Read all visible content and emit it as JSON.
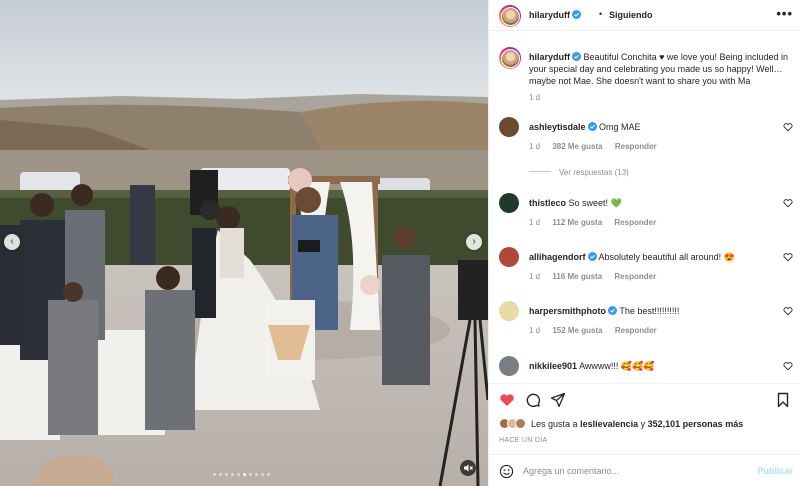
{
  "post": {
    "username": "hilaryduff",
    "follow_status": "Siguiendo",
    "more_label": "•••",
    "caption": "Beautiful Conchita ♥ we love you! Being included in your special day and celebrating you made us so happy! Well… maybe not Mae. She doesn't want to share you with Ma",
    "caption_time": "1 d"
  },
  "media": {
    "prev_icon": "‹",
    "next_icon": "›",
    "slide_count": 10,
    "active_slide": 6
  },
  "comments": [
    {
      "username": "ashleytisdale",
      "text": "Omg MAE",
      "time": "1 d",
      "likes": "382 Me gusta",
      "reply": "Responder",
      "avatar_color": "#6b4a2e"
    },
    {
      "username": "thistleco",
      "text": "So sweet! 💚",
      "time": "1 d",
      "likes": "112 Me gusta",
      "reply": "Responder",
      "avatar_color": "#1f3a2b"
    },
    {
      "username": "allihagendorf",
      "text": "Absolutely beautiful all around! 😍",
      "time": "1 d",
      "likes": "116 Me gusta",
      "reply": "Responder",
      "avatar_color": "#b0473a"
    },
    {
      "username": "harpersmithphoto",
      "text": "The best!!!!!!!!!!",
      "time": "1 d",
      "likes": "152 Me gusta",
      "reply": "Responder",
      "avatar_color": "#e7d9a8"
    },
    {
      "username": "nikkilee901",
      "text": "Awwww!!! 🥰🥰🥰",
      "time": "",
      "likes": "",
      "reply": "",
      "avatar_color": "#7a7f86"
    }
  ],
  "replies_label": "Ver respuestas (13)",
  "likes": {
    "prefix": "Les gusta a",
    "user": "lesliev​alencia",
    "connector": "y",
    "count": "352,101 personas más"
  },
  "post_time": "HACE UN DÍA",
  "comment_box": {
    "placeholder": "Agrega un comentario...",
    "publish_label": "Publicar"
  },
  "colors": {
    "verified": "#3897f0",
    "liked_heart": "#ed4956",
    "publish_disabled": "#b2dffc"
  }
}
